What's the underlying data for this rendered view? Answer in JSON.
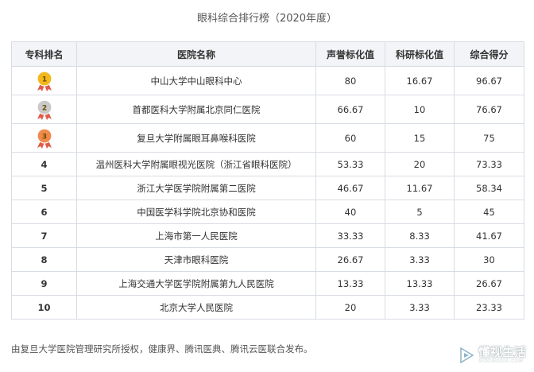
{
  "title": "眼科综合排行榜（2020年度）",
  "table": {
    "headers": [
      "专科排名",
      "医院名称",
      "声誉标化值",
      "科研标化值",
      "综合得分"
    ],
    "rows": [
      {
        "rank": "1",
        "medal": "gold",
        "hospital": "中山大学中山眼科中心",
        "reputation": "80",
        "research": "16.67",
        "score": "96.67"
      },
      {
        "rank": "2",
        "medal": "silver",
        "hospital": "首都医科大学附属北京同仁医院",
        "reputation": "66.67",
        "research": "10",
        "score": "76.67"
      },
      {
        "rank": "3",
        "medal": "bronze",
        "hospital": "复旦大学附属眼耳鼻喉科医院",
        "reputation": "60",
        "research": "15",
        "score": "75"
      },
      {
        "rank": "4",
        "medal": "",
        "hospital": "温州医科大学附属眼视光医院（浙江省眼科医院）",
        "reputation": "53.33",
        "research": "20",
        "score": "73.33"
      },
      {
        "rank": "5",
        "medal": "",
        "hospital": "浙江大学医学院附属第二医院",
        "reputation": "46.67",
        "research": "11.67",
        "score": "58.34"
      },
      {
        "rank": "6",
        "medal": "",
        "hospital": "中国医学科学院北京协和医院",
        "reputation": "40",
        "research": "5",
        "score": "45"
      },
      {
        "rank": "7",
        "medal": "",
        "hospital": "上海市第一人民医院",
        "reputation": "33.33",
        "research": "8.33",
        "score": "41.67"
      },
      {
        "rank": "8",
        "medal": "",
        "hospital": "天津市眼科医院",
        "reputation": "26.67",
        "research": "3.33",
        "score": "30"
      },
      {
        "rank": "9",
        "medal": "",
        "hospital": "上海交通大学医学院附属第九人民医院",
        "reputation": "13.33",
        "research": "13.33",
        "score": "26.67"
      },
      {
        "rank": "10",
        "medal": "",
        "hospital": "北京大学人民医院",
        "reputation": "20",
        "research": "3.33",
        "score": "23.33"
      }
    ]
  },
  "footer": "由复旦大学医院管理研究所授权，健康界、腾讯医典、腾讯云医联合发布。",
  "watermark": {
    "text": "懂视生活",
    "sub": "SIDONGSHI.COM",
    "icon": "play-logo-icon"
  },
  "colors": {
    "gold": "#f2b81c",
    "silver": "#c9c9c9",
    "bronze": "#f08a4b",
    "ribbon": "#e05a4a",
    "header_bg": "#f2f4f7",
    "border": "#d8dce3"
  }
}
